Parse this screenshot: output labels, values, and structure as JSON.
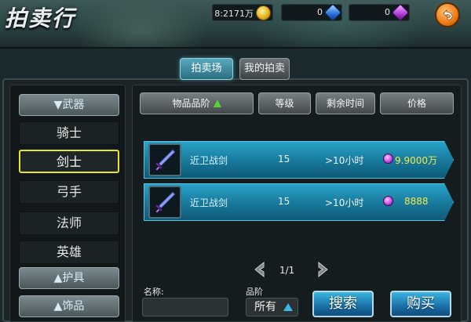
{
  "header": {
    "title": "拍卖行",
    "gold": "8:2171万",
    "blue_gems": "0",
    "purple_gems": "0",
    "icons": {
      "gold": "gold-coin-icon",
      "blue": "blue-gem-icon",
      "purple": "purple-gem-icon",
      "back": "back-arrow-icon"
    }
  },
  "tabs": [
    {
      "label": "拍卖场",
      "active": true
    },
    {
      "label": "我的拍卖",
      "active": false
    }
  ],
  "sidebar": {
    "categories": [
      {
        "label": "▼武器"
      },
      {
        "label": "▲护具"
      },
      {
        "label": "▲饰品"
      }
    ],
    "weapon_subs": [
      {
        "label": "骑士",
        "selected": false
      },
      {
        "label": "剑士",
        "selected": true
      },
      {
        "label": "弓手",
        "selected": false
      },
      {
        "label": "法师",
        "selected": false
      },
      {
        "label": "英雄",
        "selected": false
      }
    ]
  },
  "table": {
    "columns": [
      "物品品阶",
      "等级",
      "剩余时间",
      "价格"
    ],
    "sort_icon": "green-up-arrow-icon",
    "rows": [
      {
        "name": "近卫战剑",
        "level": "15",
        "time": ">10小时",
        "price": "9.9000万",
        "item_icon": "sword-icon"
      },
      {
        "name": "近卫战剑",
        "level": "15",
        "time": ">10小时",
        "price": "8888",
        "item_icon": "sword-icon"
      }
    ]
  },
  "pager": {
    "text": "1/1"
  },
  "search": {
    "name_label": "名称:",
    "name_value": "",
    "quality_label": "品阶",
    "quality_value": "所有",
    "search_button": "搜索",
    "buy_button": "购买"
  },
  "colors": {
    "row_accent": "#2aa3c9",
    "selected_border": "#e6e52a",
    "price_text": "#f3e64a",
    "back_button": "#ec7a12"
  }
}
